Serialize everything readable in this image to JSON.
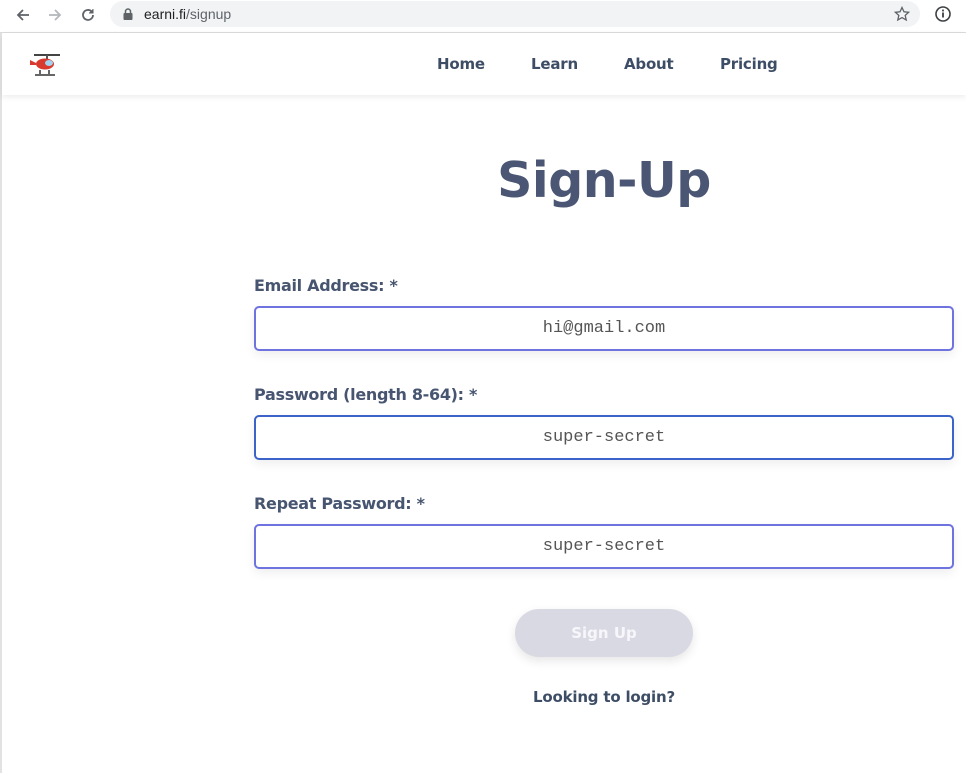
{
  "browser": {
    "url_host": "earni.fi",
    "url_path": "/signup"
  },
  "nav": {
    "links": [
      "Home",
      "Learn",
      "About",
      "Pricing"
    ]
  },
  "page": {
    "title": "Sign-Up"
  },
  "form": {
    "email_label": "Email Address: *",
    "email_value": "hi@gmail.com",
    "password_label": "Password (length 8-64): *",
    "password_value": "super-secret",
    "repeat_label": "Repeat Password: *",
    "repeat_value": "super-secret",
    "submit_label": "Sign Up",
    "login_link": "Looking to login?"
  },
  "colors": {
    "heading": "#4a5673",
    "field_border": "#6f73e0",
    "focused_border": "#3b63c9",
    "button_disabled": "#d8d9e2"
  },
  "icons": [
    "back-arrow-icon",
    "forward-arrow-icon",
    "reload-icon",
    "lock-icon",
    "star-icon",
    "info-icon",
    "helicopter-logo-icon"
  ]
}
